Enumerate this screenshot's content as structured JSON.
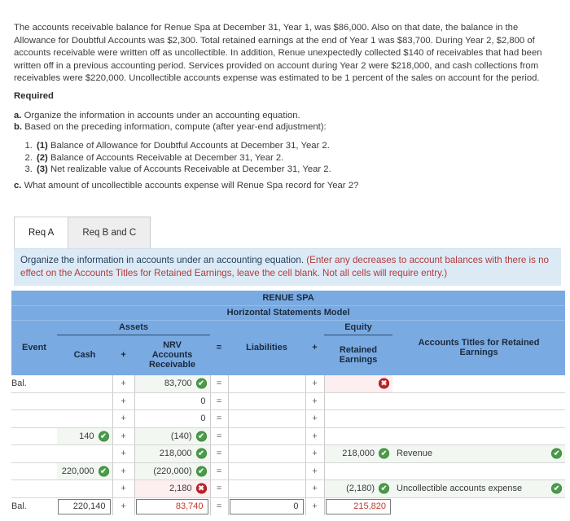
{
  "problem": {
    "narrative": "The accounts receivable balance for Renue Spa at December 31, Year 1, was $86,000. Also on that date, the balance in the Allowance for Doubtful Accounts was $2,300. Total retained earnings at the end of Year 1 was $83,700. During Year 2, $2,800 of accounts receivable were written off as uncollectible. In addition, Renue unexpectedly collected $140 of receivables that had been written off in a previous accounting period. Services provided on account during Year 2 were $218,000, and cash collections from receivables were $220,000. Uncollectible accounts expense was estimated to be 1 percent of the sales on account for the period.",
    "required_heading": "Required",
    "req_a_marker": "a.",
    "req_a_text": "Organize the information in accounts under an accounting equation.",
    "req_b_marker": "b.",
    "req_b_text": "Based on the preceding information, compute (after year-end adjustment):",
    "sub_items": [
      {
        "marker": "(1)",
        "text": "Balance of Allowance for Doubtful Accounts at December 31, Year 2."
      },
      {
        "marker": "(2)",
        "text": "Balance of Accounts Receivable at December 31, Year 2."
      },
      {
        "marker": "(3)",
        "text": "Net realizable value of Accounts Receivable at December 31, Year 2."
      }
    ],
    "req_c_marker": "c.",
    "req_c_text": "What amount of uncollectible accounts expense will Renue Spa record for Year 2?"
  },
  "tabs": [
    {
      "label": "Req A",
      "active": true
    },
    {
      "label": "Req B and C",
      "active": false
    }
  ],
  "banner": {
    "instruction": "Organize the information in accounts under an accounting equation. ",
    "hint": "(Enter any decreases to account balances with there is no effect on the Accounts Titles for Retained Earnings, leave the cell blank. Not all cells will require entry.)"
  },
  "table": {
    "company": "RENUE SPA",
    "subtitle": "Horizontal Statements Model",
    "group_assets": "Assets",
    "group_equity": "Equity",
    "col_event": "Event",
    "col_cash": "Cash",
    "col_plus1": "+",
    "col_nrv": "NRV Accounts Receivable",
    "col_nrv_l1": "NRV",
    "col_nrv_l2": "Accounts",
    "col_nrv_l3": "Receivable",
    "col_equals": "=",
    "col_liabilities": "Liabilities",
    "col_plus2": "+",
    "col_re_l1": "Retained",
    "col_re_l2": "Earnings",
    "col_titles_l1": "Accounts Titles for Retained",
    "col_titles_l2": "Earnings",
    "rows": [
      {
        "event": "Bal.",
        "cash": "",
        "cash_state": "empty",
        "nrv": "83,700",
        "nrv_state": "ok",
        "liab": "",
        "liab_state": "empty",
        "re": "",
        "re_state": "bad",
        "title": "",
        "title_state": "empty"
      },
      {
        "event": "",
        "cash": "",
        "cash_state": "empty",
        "nrv": "0",
        "nrv_state": "none",
        "liab": "",
        "liab_state": "empty",
        "re": "",
        "re_state": "empty",
        "title": "",
        "title_state": "empty"
      },
      {
        "event": "",
        "cash": "",
        "cash_state": "empty",
        "nrv": "0",
        "nrv_state": "none",
        "liab": "",
        "liab_state": "empty",
        "re": "",
        "re_state": "empty",
        "title": "",
        "title_state": "empty"
      },
      {
        "event": "",
        "cash": "140",
        "cash_state": "ok",
        "nrv": "(140)",
        "nrv_state": "ok",
        "liab": "",
        "liab_state": "empty",
        "re": "",
        "re_state": "empty",
        "title": "",
        "title_state": "empty"
      },
      {
        "event": "",
        "cash": "",
        "cash_state": "empty",
        "nrv": "218,000",
        "nrv_state": "ok",
        "liab": "",
        "liab_state": "empty",
        "re": "218,000",
        "re_state": "ok",
        "title": "Revenue",
        "title_state": "ok"
      },
      {
        "event": "",
        "cash": "220,000",
        "cash_state": "ok",
        "nrv": "(220,000)",
        "nrv_state": "ok",
        "liab": "",
        "liab_state": "empty",
        "re": "",
        "re_state": "empty",
        "title": "",
        "title_state": "empty"
      },
      {
        "event": "",
        "cash": "",
        "cash_state": "empty",
        "nrv": "2,180",
        "nrv_state": "bad",
        "liab": "",
        "liab_state": "empty",
        "re": "(2,180)",
        "re_state": "ok",
        "title": "Uncollectible accounts expense",
        "title_state": "ok"
      }
    ],
    "balance_row": {
      "event": "Bal.",
      "cash": "220,140",
      "nrv": "83,740",
      "liab": "0",
      "re": "215,820",
      "title": ""
    }
  },
  "icons": {
    "check": "✔",
    "cross": "✖"
  },
  "colors": {
    "header_blue": "#7aaae2",
    "banner_blue": "#dceaf6",
    "hint_red": "#b23a3a",
    "value_red": "#c0392b",
    "ok_green": "#4a9b4a",
    "bad_red": "#c0222a"
  }
}
